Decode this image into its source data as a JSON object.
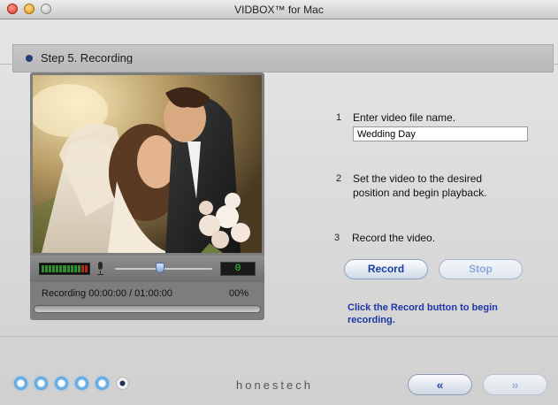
{
  "window": {
    "title": "VIDBOX™ for Mac"
  },
  "step": {
    "label": "Step 5. Recording"
  },
  "player": {
    "level_value": "0",
    "recording_status": "Recording 00:00:00 / 01:00:00",
    "progress_percent_text": "00%",
    "progress_fraction": 0.0,
    "volume_fraction": 0.46
  },
  "instructions": {
    "step1": {
      "number": "1",
      "text": "Enter video file name."
    },
    "step2": {
      "number": "2",
      "line1": "Set the video to the desired",
      "line2": "position and begin playback."
    },
    "step3": {
      "number": "3",
      "text": "Record the video."
    }
  },
  "filename": {
    "value": "Wedding Day"
  },
  "buttons": {
    "record": "Record",
    "stop": "Stop"
  },
  "hint": {
    "text": "Click the Record button to begin recording."
  },
  "footer": {
    "brand": "honestech",
    "back": "«",
    "next": "»",
    "steps_total": 6,
    "current_step": 6
  },
  "colors": {
    "accent": "#1d36a8",
    "step_dot": "#243c78",
    "level_text": "#39d439"
  },
  "icons": [
    "microphone-icon",
    "double-chevron-left-icon",
    "double-chevron-right-icon"
  ]
}
